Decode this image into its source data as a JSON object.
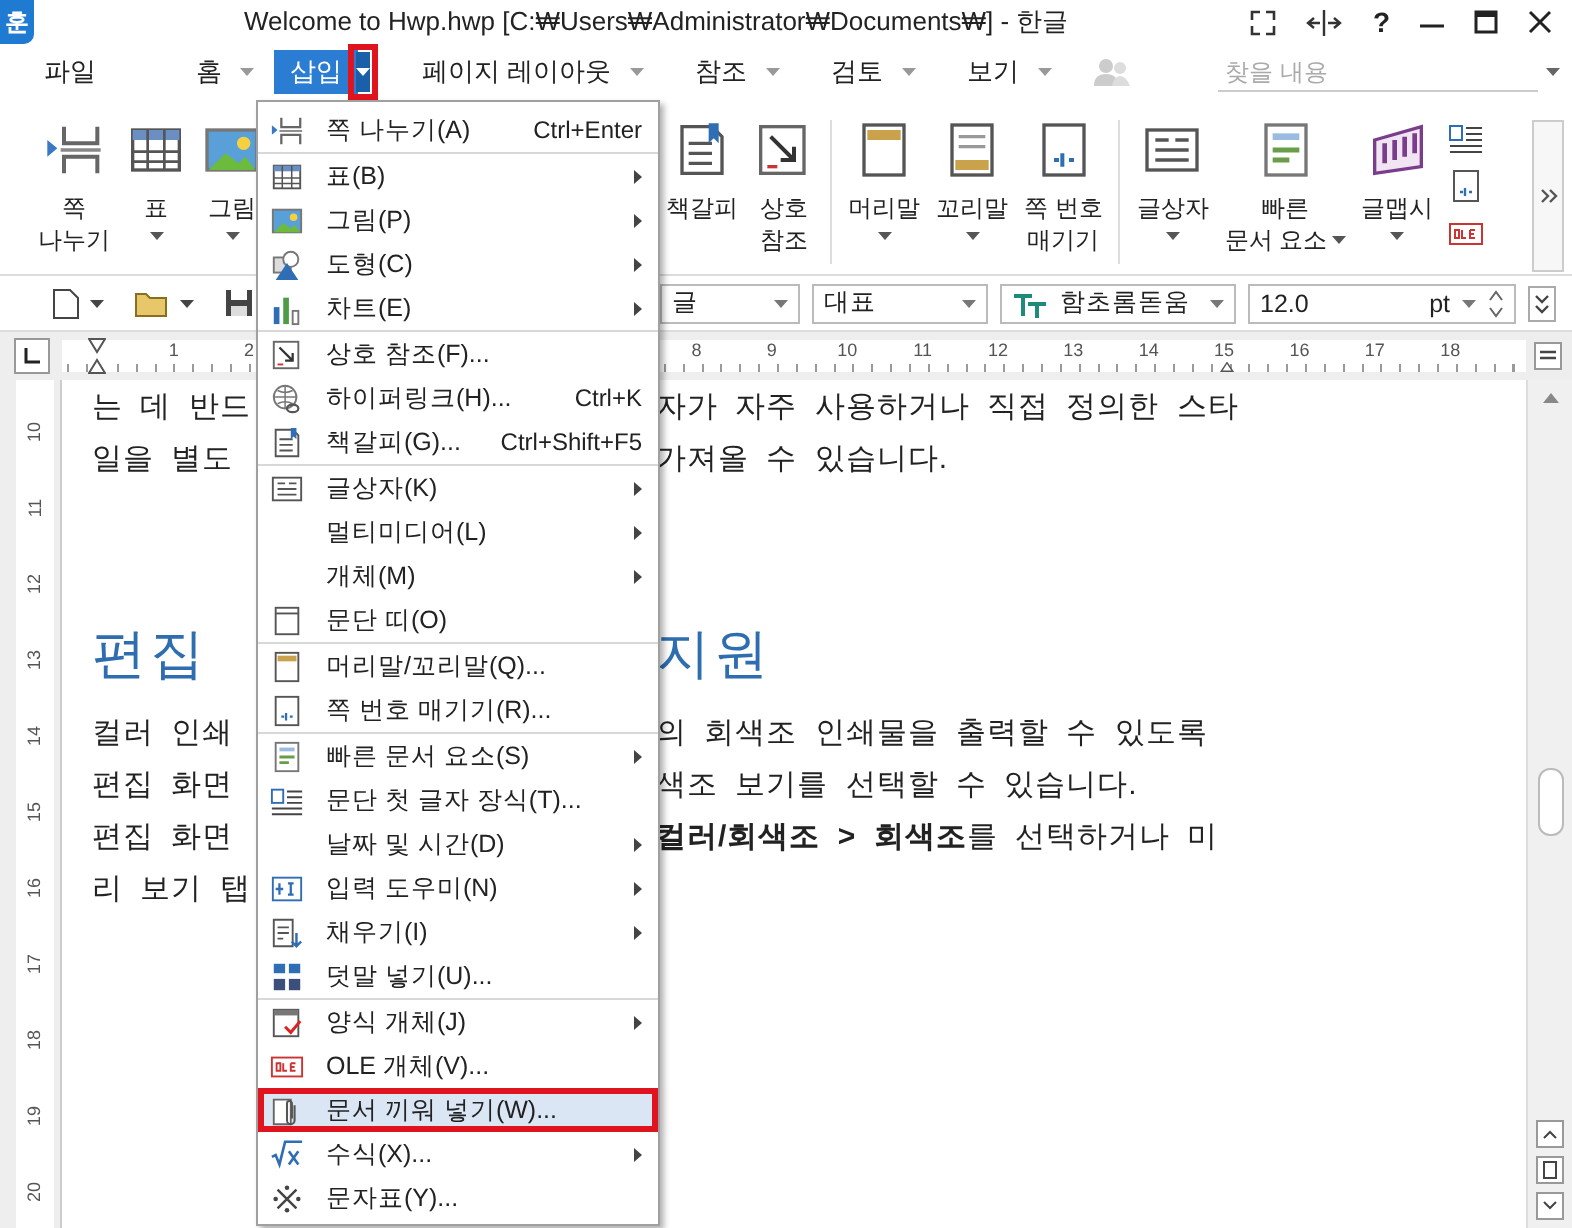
{
  "window": {
    "logo": "훈",
    "title": "Welcome to Hwp.hwp [C:₩Users₩Administrator₩Documents₩] - 한글",
    "help": "?"
  },
  "menu_tabs": [
    {
      "label": "파일",
      "selected": false,
      "has_dropdown": false
    },
    {
      "label": "홈",
      "selected": false,
      "has_dropdown": true
    },
    {
      "label": "삽입",
      "selected": true,
      "has_dropdown": true,
      "marked": true
    },
    {
      "label": "페이지 레이아웃",
      "selected": false,
      "has_dropdown": true
    },
    {
      "label": "참조",
      "selected": false,
      "has_dropdown": true
    },
    {
      "label": "검토",
      "selected": false,
      "has_dropdown": true
    },
    {
      "label": "보기",
      "selected": false,
      "has_dropdown": true
    }
  ],
  "search": {
    "placeholder": "찾을 내용"
  },
  "ribbon": {
    "left": [
      {
        "lines": [
          "쪽",
          "나누기"
        ]
      },
      {
        "lines": [
          "표"
        ],
        "has_dropdown": true
      },
      {
        "lines": [
          "그림"
        ],
        "has_dropdown": true
      }
    ],
    "right_groups": [
      [
        {
          "lines": [
            "책갈피"
          ]
        },
        {
          "lines": [
            "상호",
            "참조"
          ]
        }
      ],
      [
        {
          "lines": [
            "머리말"
          ],
          "has_dropdown": true
        },
        {
          "lines": [
            "꼬리말"
          ],
          "has_dropdown": true
        },
        {
          "lines": [
            "쪽 번호",
            "매기기"
          ]
        }
      ],
      [
        {
          "lines": [
            "글상자"
          ],
          "has_dropdown": true
        },
        {
          "lines": [
            "빠른",
            "문서 요소"
          ],
          "has_dropdown": true
        },
        {
          "lines": [
            "글맵시"
          ],
          "has_dropdown": true
        }
      ]
    ]
  },
  "toolbar": {
    "combos": [
      {
        "kind": "style",
        "value": "글"
      },
      {
        "kind": "style",
        "value": "대표"
      },
      {
        "kind": "font",
        "value": "함초롬돋움"
      }
    ],
    "size": {
      "value": "12.0",
      "unit": "pt"
    }
  },
  "ruler": {
    "left_numbers": [
      "1",
      "2"
    ],
    "right_numbers": [
      "8",
      "9",
      "10",
      "11",
      "12",
      "13",
      "14",
      "15",
      "16",
      "17",
      "18"
    ]
  },
  "vertical_ruler": {
    "numbers": [
      "10",
      "11",
      "12",
      "13",
      "14",
      "15",
      "16",
      "17",
      "18",
      "19",
      "20"
    ]
  },
  "document": {
    "lines": [
      {
        "kind": "text",
        "left": "는 데 반드",
        "right": "자가 자주 사용하거나 직접 정의한 스타"
      },
      {
        "kind": "text",
        "left": "일을 별도",
        "right": "가져올 수 있습니다."
      },
      {
        "kind": "heading",
        "left": "편집",
        "right": "지원"
      },
      {
        "kind": "text",
        "left": "컬러 인쇄",
        "right": "의 회색조 인쇄물을 출력할 수 있도록"
      },
      {
        "kind": "text",
        "left": "편집 화면",
        "right": "색조 보기를 선택할 수 있습니다."
      },
      {
        "kind": "text",
        "left": "편집 화면",
        "right": "**컬러/회색조 > 회색조**를 선택하거나 미"
      },
      {
        "kind": "text",
        "left": "리 보기 탭"
      }
    ]
  },
  "insert_menu": {
    "items": [
      {
        "label": "쪽 나누기(A)",
        "shortcut": "Ctrl+Enter",
        "submenu": false,
        "selected": false,
        "separator_after": true
      },
      {
        "label": "표(B)",
        "submenu": true,
        "selected": false
      },
      {
        "label": "그림(P)",
        "submenu": true,
        "selected": false
      },
      {
        "label": "도형(C)",
        "submenu": true,
        "selected": false
      },
      {
        "label": "차트(E)",
        "submenu": true,
        "selected": false,
        "separator_after": true
      },
      {
        "label": "상호 참조(F)...",
        "submenu": false,
        "selected": false
      },
      {
        "label": "하이퍼링크(H)...",
        "shortcut": "Ctrl+K",
        "submenu": false,
        "selected": false
      },
      {
        "label": "책갈피(G)...",
        "shortcut": "Ctrl+Shift+F5",
        "submenu": false,
        "selected": false,
        "separator_after": true
      },
      {
        "label": "글상자(K)",
        "submenu": true,
        "selected": false
      },
      {
        "label": "멀티미디어(L)",
        "submenu": true,
        "selected": false
      },
      {
        "label": "개체(M)",
        "submenu": true,
        "selected": false
      },
      {
        "label": "문단 띠(O)",
        "submenu": false,
        "selected": false,
        "separator_after": true
      },
      {
        "label": "머리말/꼬리말(Q)...",
        "submenu": false,
        "selected": false
      },
      {
        "label": "쪽 번호 매기기(R)...",
        "submenu": false,
        "selected": false,
        "separator_after": true
      },
      {
        "label": "빠른 문서 요소(S)",
        "submenu": true,
        "selected": false
      },
      {
        "label": "문단 첫 글자 장식(T)...",
        "submenu": false,
        "selected": false
      },
      {
        "label": "날짜 및 시간(D)",
        "submenu": true,
        "selected": false
      },
      {
        "label": "입력 도우미(N)",
        "submenu": true,
        "selected": false
      },
      {
        "label": "채우기(I)",
        "submenu": true,
        "selected": false
      },
      {
        "label": "덧말 넣기(U)...",
        "submenu": false,
        "selected": false,
        "separator_after": true
      },
      {
        "label": "양식 개체(J)",
        "submenu": true,
        "selected": false
      },
      {
        "label": "OLE 개체(V)...",
        "submenu": false,
        "selected": false
      },
      {
        "label": "문서 끼워 넣기(W)...",
        "submenu": false,
        "selected": true,
        "marked": true
      },
      {
        "label": "수식(X)...",
        "submenu": true,
        "selected": false
      },
      {
        "label": "문자표(Y)...",
        "submenu": false,
        "selected": false
      }
    ]
  }
}
